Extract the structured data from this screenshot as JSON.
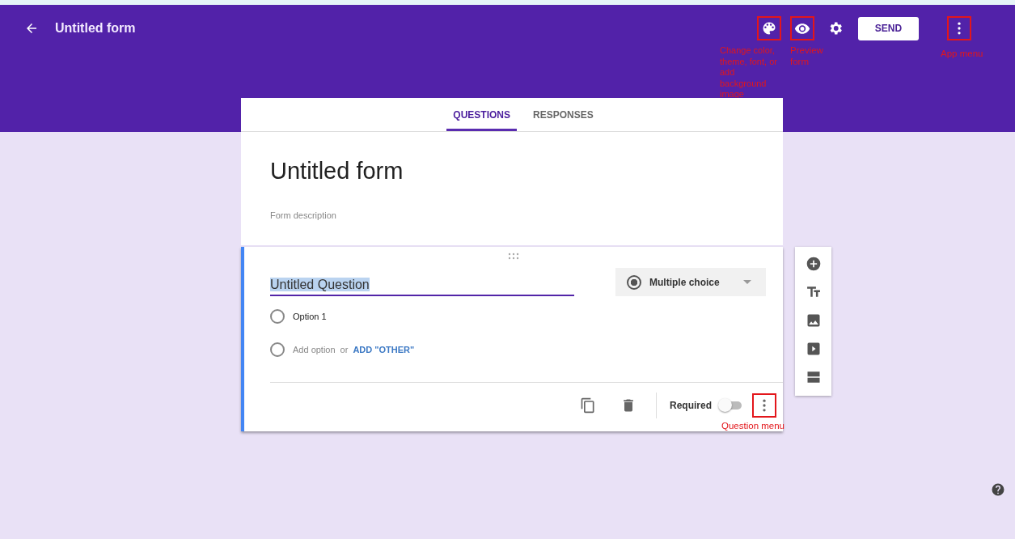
{
  "header": {
    "title": "Untitled form",
    "actions": [
      {
        "kind": "palette",
        "annotation": "Change color, theme, font, or add background image"
      },
      {
        "kind": "eye",
        "annotation": "Preview form"
      },
      {
        "kind": "gear"
      },
      {
        "kind": "send",
        "label": "SEND"
      },
      {
        "kind": "more",
        "annotation": "App menu"
      }
    ]
  },
  "tabs": [
    {
      "label": "QUESTIONS",
      "selected": true
    },
    {
      "label": "RESPONSES",
      "selected": false
    }
  ],
  "form": {
    "title": "Untitled form",
    "description_placeholder": "Form description"
  },
  "question": {
    "title": "Untitled Question",
    "title_highlighted": true,
    "type": "Multiple choice",
    "options": [
      {
        "label": "Option 1",
        "selected": false
      }
    ],
    "add_option": "Add option",
    "add_option_selected": false,
    "or": "or",
    "add_other": "ADD \"OTHER\"",
    "required_label": "Required",
    "required": false,
    "menu_annotation": "Question menu"
  }
}
